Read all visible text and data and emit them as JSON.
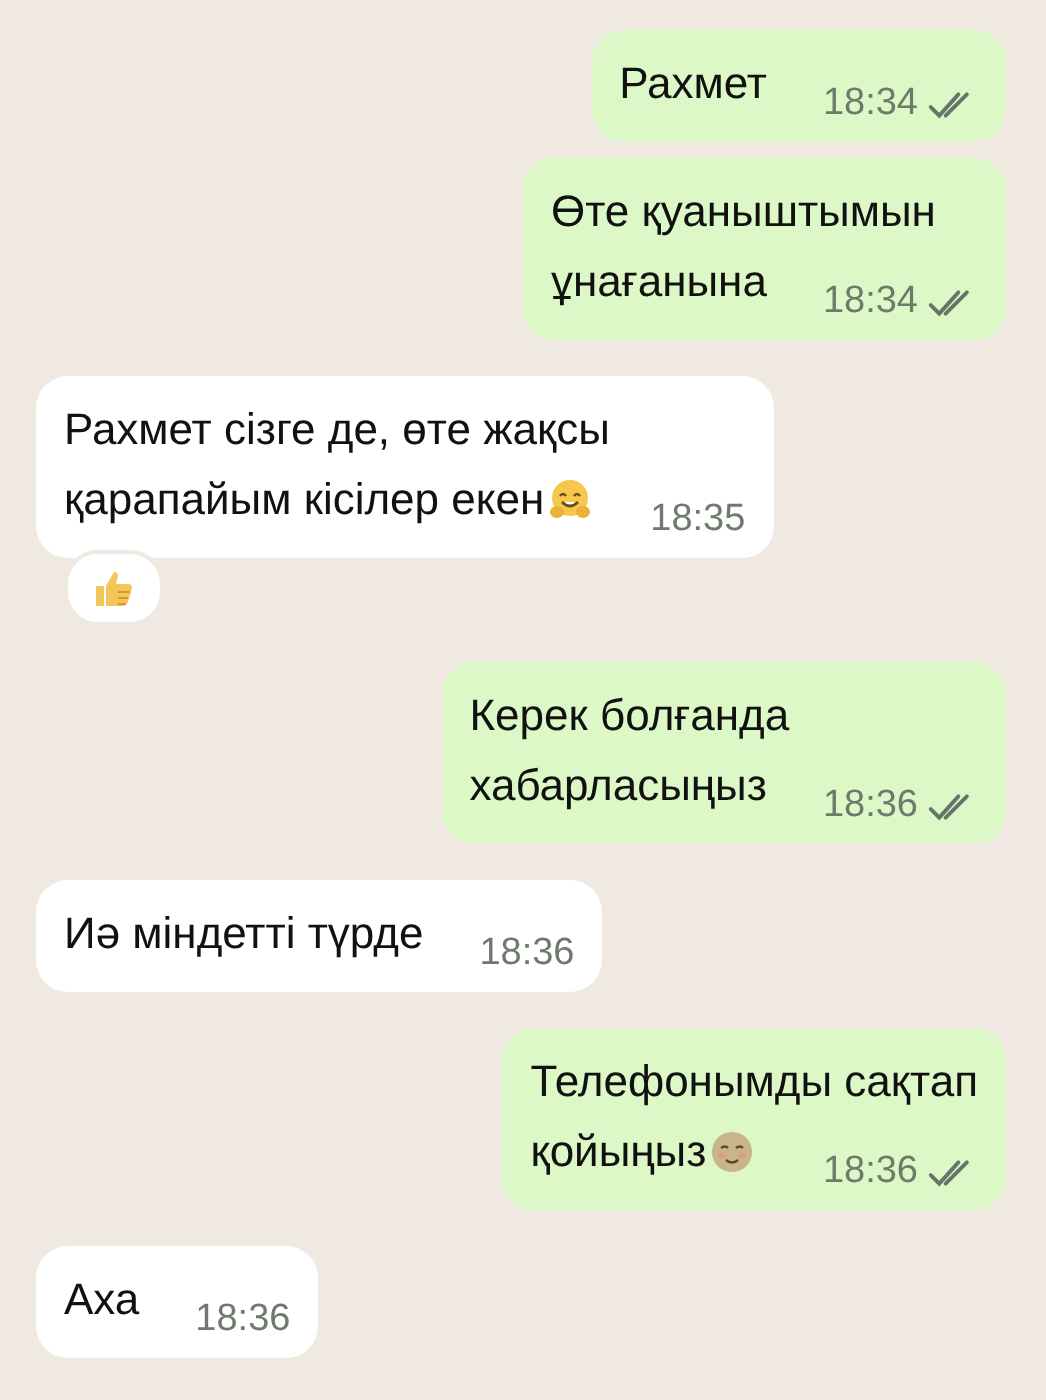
{
  "messages": [
    {
      "kind": "outgoing",
      "lines": [
        "Рахмет"
      ],
      "time": "18:34",
      "read": false
    },
    {
      "kind": "outgoing",
      "lines": [
        "Өте қуаныштымын",
        "ұнағанына"
      ],
      "time": "18:34",
      "read": false
    },
    {
      "kind": "incoming",
      "lines": [
        "Рахмет сізге де, өте жақсы",
        "қарапайым кісілер екен"
      ],
      "emoji": {
        "kind": "hug"
      },
      "time": "18:35",
      "reaction": {
        "kind": "thumbs_up"
      }
    },
    {
      "kind": "outgoing",
      "lines": [
        "Керек болғанда",
        "хабарласыңыз"
      ],
      "time": "18:36",
      "read": false
    },
    {
      "kind": "incoming",
      "lines": [
        "Иә міндетті түрде"
      ],
      "time": "18:36"
    },
    {
      "kind": "outgoing",
      "lines": [
        "Телефонымды сақтап",
        "қойыңыз"
      ],
      "emoji": {
        "kind": "smile"
      },
      "time": "18:36",
      "read": false
    },
    {
      "kind": "incoming",
      "lines": [
        "Аха"
      ],
      "time": "18:36"
    }
  ]
}
